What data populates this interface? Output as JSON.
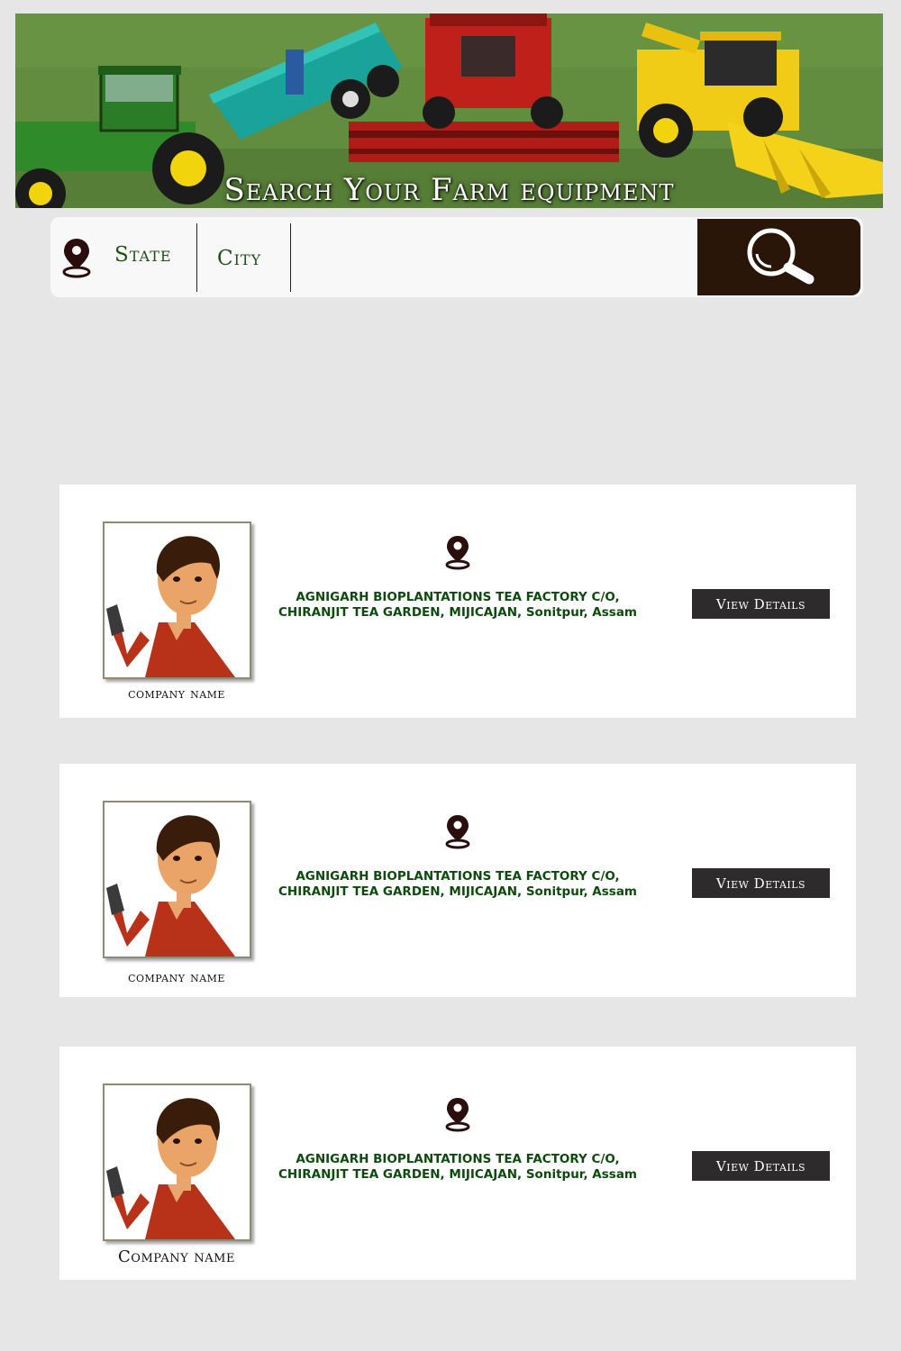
{
  "banner": {
    "title": "Search Your Farm equipment"
  },
  "search": {
    "state_label": "State",
    "city_label": "City",
    "input_value": "",
    "icons": {
      "location": "map-pin-icon",
      "search": "magnifier-icon"
    }
  },
  "colors": {
    "background": "#e6e6e6",
    "search_button": "#2a1608",
    "label_green": "#1f4f14",
    "address_green": "#0d4a0d",
    "view_button": "#2d2b2b"
  },
  "listings": [
    {
      "company_name": "company name",
      "address_line1": "AGNIGARH BIOPLANTATIONS TEA FACTORY C/O,",
      "address_line2": "CHIRANJIT TEA GARDEN, MIJICAJAN, Sonitpur, Assam",
      "button_label": "View Details"
    },
    {
      "company_name": "company name",
      "address_line1": "AGNIGARH BIOPLANTATIONS TEA FACTORY C/O,",
      "address_line2": "CHIRANJIT TEA GARDEN, MIJICAJAN, Sonitpur, Assam",
      "button_label": "View Details"
    },
    {
      "company_name": "Company name",
      "address_line1": "AGNIGARH BIOPLANTATIONS TEA FACTORY C/O,",
      "address_line2": "CHIRANJIT TEA GARDEN, MIJICAJAN, Sonitpur, Assam",
      "button_label": "View Details"
    }
  ]
}
